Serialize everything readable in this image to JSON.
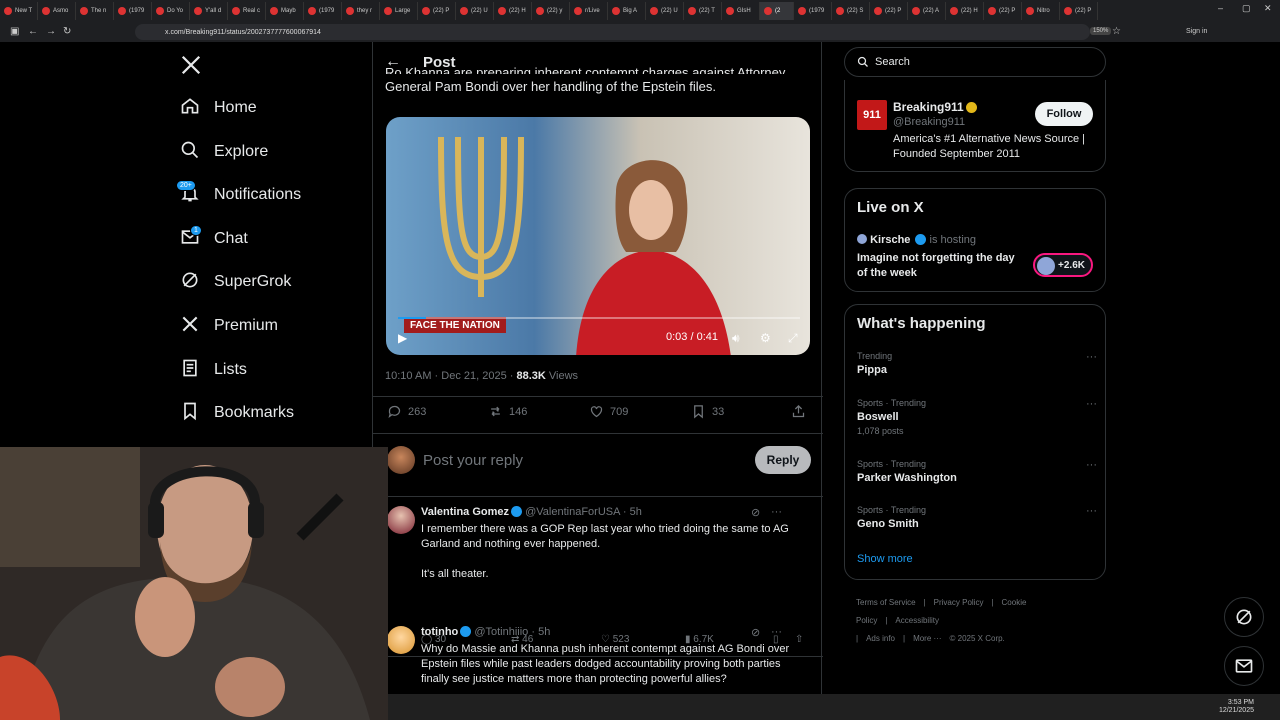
{
  "browser": {
    "tabs": [
      "New T",
      "Asmo",
      "The n",
      "(1979",
      "Do Yo",
      "Y'all d",
      "Real c",
      "Mayb",
      "(1979",
      "they r",
      "Large",
      "(22) P",
      "(22) U",
      "(22) H",
      "(22) y",
      "r/Live",
      "Big A",
      "(22) U",
      "(22) T",
      "GIsH",
      "(2",
      "(1979",
      "(22) S",
      "(22) P",
      "(22) A",
      "(22) H",
      "(22) P",
      "Nitro",
      "(22) P"
    ],
    "url": "x.com/Breaking911/status/2002737777600067914",
    "zoom": "150%",
    "signin": "Sign in"
  },
  "nav": {
    "items": [
      {
        "label": "Home",
        "icon": "home-icon"
      },
      {
        "label": "Explore",
        "icon": "search-icon"
      },
      {
        "label": "Notifications",
        "icon": "bell-icon",
        "badge": "20+"
      },
      {
        "label": "Chat",
        "icon": "mail-icon",
        "badge": "1"
      },
      {
        "label": "SuperGrok",
        "icon": "grok-icon"
      },
      {
        "label": "Premium",
        "icon": "x-icon"
      },
      {
        "label": "Lists",
        "icon": "list-icon"
      },
      {
        "label": "Bookmarks",
        "icon": "bookmark-icon"
      }
    ]
  },
  "post": {
    "header": "Post",
    "text_line1": "Ro Khanna are preparing inherent contempt charges against Attorney",
    "text_line2": "General Pam Bondi over her handling of the Epstein files.",
    "video": {
      "network": "FACE THE NATION",
      "time": "0:03 / 0:41",
      "progress": 0.07
    },
    "timestamp": "10:10 AM · Dec 21, 2025 · ",
    "views": "88.3K",
    "views_label": " Views",
    "stats": {
      "replies": "263",
      "reposts": "146",
      "likes": "709",
      "bookmarks": "33"
    }
  },
  "reply_box": {
    "placeholder": "Post your reply",
    "button": "Reply"
  },
  "replies": [
    {
      "name": "Valentina Gomez",
      "handle": "@ValentinaForUSA · 5h",
      "text1": "I remember there was a GOP Rep last year who tried doing the same to AG Garland and nothing ever happened.",
      "text2": "It's all theater.",
      "replies": "30",
      "reposts": "46",
      "likes": "523",
      "views": "6.7K"
    },
    {
      "name": "totinho",
      "handle": "@Totinhiiio · 5h",
      "text1": "Why do Massie and Khanna push inherent contempt against AG Bondi over Epstein files while past leaders dodged accountability proving both parties finally see justice matters more than protecting powerful allies?"
    }
  ],
  "sidebar": {
    "search_placeholder": "Search",
    "who": {
      "logo_text": "911",
      "name": "Breaking911",
      "handle": "@Breaking911",
      "bio": "America's #1 Alternative News Source | Founded September 2011",
      "follow": "Follow"
    },
    "live": {
      "title": "Live on X",
      "host": "Kirsche",
      "hosting": "is hosting",
      "stream_title": "Imagine not forgetting the day of the week",
      "count": "+2.6K"
    },
    "happening": {
      "title": "What's happening",
      "trends": [
        {
          "category": "Trending",
          "name": "Pippa",
          "posts": ""
        },
        {
          "category": "Sports · Trending",
          "name": "Boswell",
          "posts": "1,078 posts"
        },
        {
          "category": "Sports · Trending",
          "name": "Parker Washington",
          "posts": ""
        },
        {
          "category": "Sports · Trending",
          "name": "Geno Smith",
          "posts": ""
        }
      ],
      "show_more": "Show more"
    },
    "footer": [
      "Terms of Service",
      "|",
      "Privacy Policy",
      "|",
      "Cookie Policy",
      "|",
      "Accessibility",
      "|",
      "Ads info",
      "|",
      "More ···",
      "© 2025 X Corp."
    ]
  },
  "taskbar": {
    "time": "3:53 PM",
    "date": "12/21/2025"
  }
}
